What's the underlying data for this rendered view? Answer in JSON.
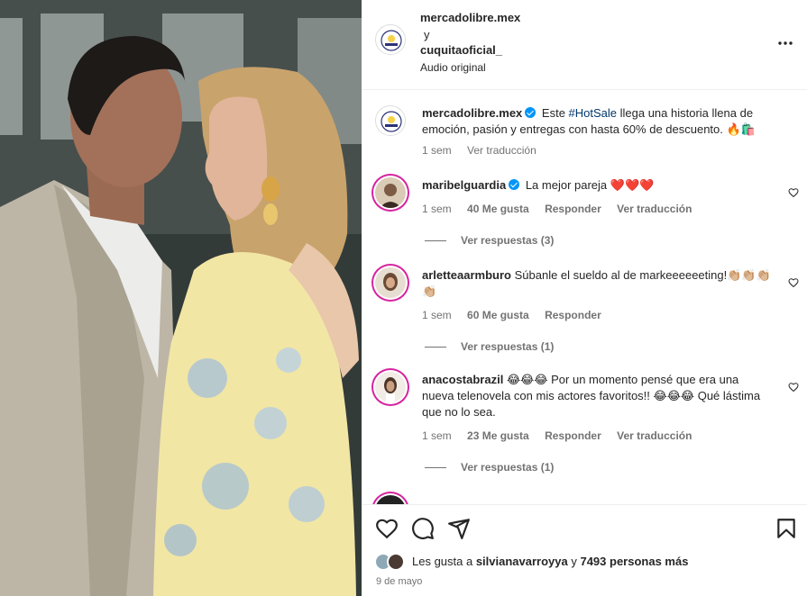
{
  "header": {
    "account1": "mercadolibre.mex",
    "connector": "y",
    "account2": "cuquitaoficial_",
    "audio": "Audio original"
  },
  "caption": {
    "user": "mercadolibre.mex",
    "text_pre": "Este ",
    "hashtag": "#HotSale",
    "text_post": " llega una historia llena de emoción, pasión y entregas con hasta 60% de descuento. 🔥🛍️",
    "time": "1 sem",
    "translate": "Ver traducción"
  },
  "comments": [
    {
      "user": "maribelguardia",
      "verified": true,
      "text": "La mejor pareja ❤️❤️❤️",
      "time": "1 sem",
      "likes": "40 Me gusta",
      "reply": "Responder",
      "translate": "Ver traducción",
      "replies": "Ver respuestas (3)"
    },
    {
      "user": "arletteaarmburo",
      "verified": false,
      "text": "Súbanle el sueldo al de markeeeeeeting!👏🏼👏🏼👏🏼👏🏼",
      "time": "1 sem",
      "likes": "60 Me gusta",
      "reply": "Responder",
      "translate": "",
      "replies": "Ver respuestas (1)"
    },
    {
      "user": "anacostabrazil",
      "verified": false,
      "text": "😂😂😂 Por un momento pensé que era una nueva telenovela con mis actores favoritos!! 😂😂😂 Qué lástima que no lo sea.",
      "time": "1 sem",
      "likes": "23 Me gusta",
      "reply": "Responder",
      "translate": "Ver traducción",
      "replies": "Ver respuestas (1)"
    }
  ],
  "footer": {
    "likes_prefix": "Les gusta a ",
    "liker": "silvianavarroyya",
    "likes_mid": " y ",
    "others": "7493 personas más",
    "date": "9 de mayo"
  },
  "icons": {
    "like": "heart-icon",
    "comment": "comment-icon",
    "share": "send-icon",
    "save": "bookmark-icon",
    "more": "more-icon"
  }
}
